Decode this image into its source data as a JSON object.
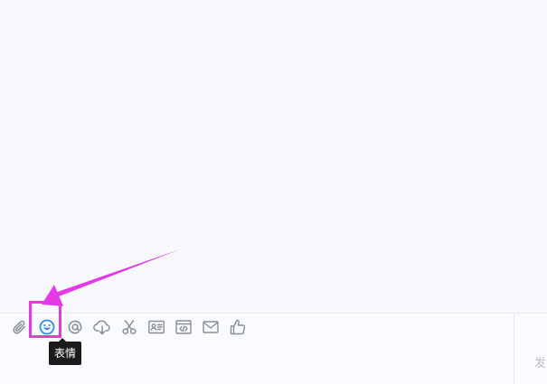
{
  "toolbar": {
    "buttons": [
      {
        "id": "attachment",
        "icon": "paperclip-icon"
      },
      {
        "id": "emoji",
        "icon": "smiley-face-icon",
        "active": true
      },
      {
        "id": "mention",
        "icon": "at-sign-icon"
      },
      {
        "id": "cloud-file",
        "icon": "cloud-download-icon"
      },
      {
        "id": "screenshot",
        "icon": "scissors-icon"
      },
      {
        "id": "business-card",
        "icon": "id-card-icon"
      },
      {
        "id": "code",
        "icon": "code-window-icon"
      },
      {
        "id": "email",
        "icon": "envelope-icon"
      },
      {
        "id": "like",
        "icon": "thumbs-up-icon"
      }
    ],
    "tooltip": "表情"
  },
  "send": {
    "label": "发"
  },
  "colors": {
    "icon_gray": "#8a8e97",
    "active_blue": "#2e8ef0",
    "annotation_magenta": "#e539e5",
    "tooltip_bg": "#1b1b1b",
    "background": "#f8f9fd"
  }
}
